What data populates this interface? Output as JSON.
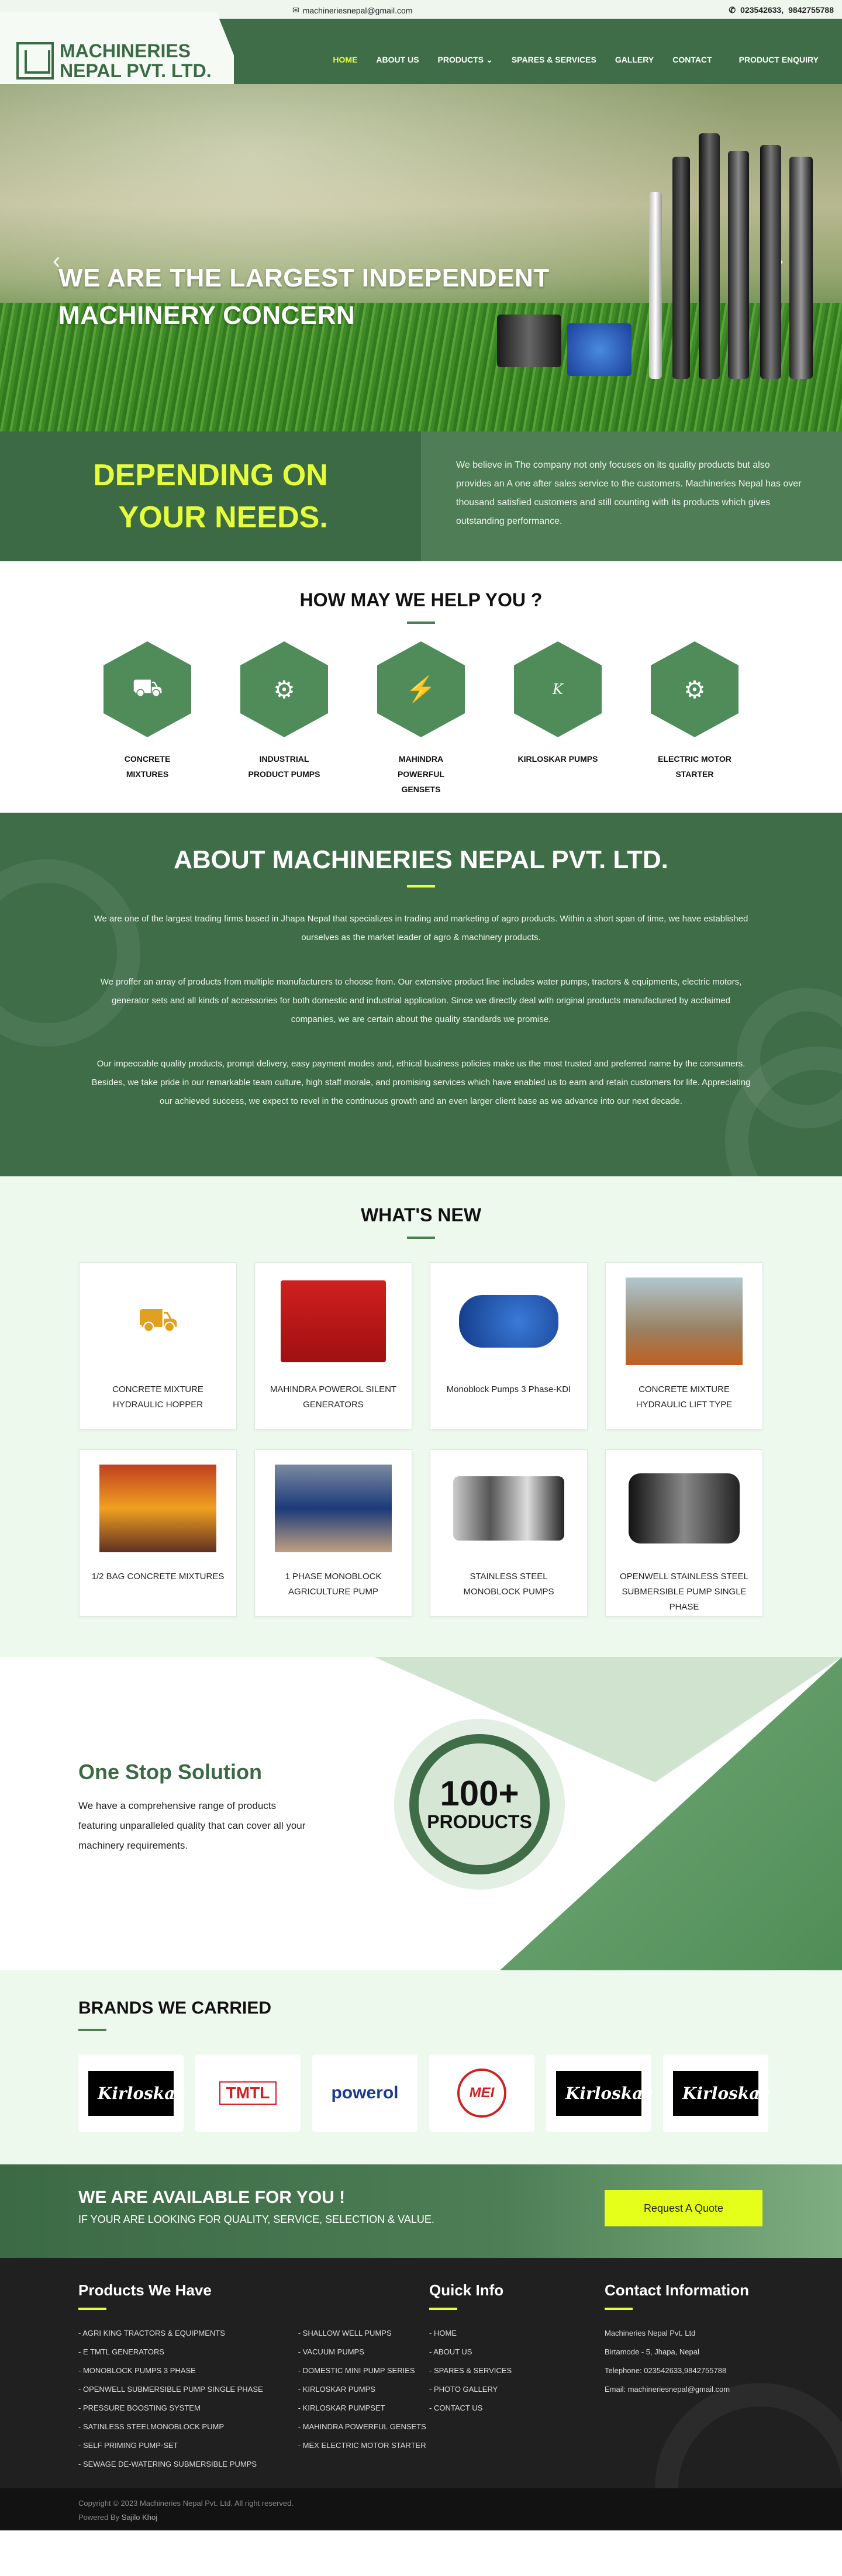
{
  "topbar": {
    "email": "machineriesnepal@gmail.com",
    "phone1": "023542633,",
    "phone2": "9842755788"
  },
  "brand": {
    "line1": "MACHINERIES",
    "line2": "NEPAL PVT. LTD."
  },
  "nav": {
    "home": "HOME",
    "about": "ABOUT US",
    "products": "PRODUCTS",
    "spares": "SPARES & SERVICES",
    "gallery": "GALLERY",
    "contact": "CONTACT",
    "enquiry": "PRODUCT ENQUIRY"
  },
  "hero": {
    "line1": "WE ARE THE LARGEST INDEPENDENT",
    "line2": "MACHINERY CONCERN"
  },
  "depend": {
    "line1": "DEPENDING ON",
    "line2": "YOUR NEEDS.",
    "text": "We believe in The company not only focuses on its quality products but also provides an A one after sales service to the customers. Machineries Nepal has over thousand satisfied customers and still counting with its products which gives outstanding performance."
  },
  "help": {
    "title": "HOW MAY WE HELP YOU ?",
    "items": [
      {
        "label": "CONCRETE MIXTURES",
        "icon": "mixer-truck-icon"
      },
      {
        "label": "INDUSTRIAL PRODUCT PUMPS",
        "icon": "pump-icon"
      },
      {
        "label": "MAHINDRA POWERFUL GENSETS",
        "icon": "generator-icon"
      },
      {
        "label": "KIRLOSKAR PUMPS",
        "icon": "kirloskar-icon"
      },
      {
        "label": "ELECTRIC MOTOR STARTER",
        "icon": "motor-icon"
      }
    ]
  },
  "about": {
    "title": "ABOUT MACHINERIES NEPAL PVT. LTD.",
    "p1": "We are one of the largest trading firms based in Jhapa Nepal that specializes in trading and marketing of agro products. Within a short span of time, we have established ourselves as the market leader of agro & machinery products.",
    "p2": "We proffer an array of products from multiple manufacturers to choose from. Our extensive product line includes water pumps, tractors & equipments, electric motors, generator sets and all kinds of accessories for both domestic and industrial application. Since we directly deal with original products manufactured by acclaimed companies, we are certain about the quality standards we promise.",
    "p3": "Our impeccable quality products, prompt delivery, easy payment modes and, ethical business policies make us the most trusted and preferred name by the consumers. Besides, we take pride in our remarkable team culture, high staff morale, and promising services which have enabled us to earn and retain customers for life. Appreciating our achieved success, we expect to revel in the continuous growth and an even larger client base as we advance into our next decade."
  },
  "new": {
    "title": "WHAT'S NEW",
    "items": [
      {
        "l1": "CONCRETE MIXTURE",
        "l2": "HYDRAULIC HOPPER"
      },
      {
        "l1": "MAHINDRA POWEROL SILENT",
        "l2": "GENERATORS"
      },
      {
        "l1": "Monoblock Pumps 3 Phase-KDI",
        "l2": ""
      },
      {
        "l1": "CONCRETE MIXTURE",
        "l2": "HYDRAULIC LIFT TYPE"
      },
      {
        "l1": "1/2 BAG CONCRETE MIXTURES",
        "l2": ""
      },
      {
        "l1": "1 PHASE MONOBLOCK",
        "l2": "AGRICULTURE PUMP"
      },
      {
        "l1": "STAINLESS STEEL",
        "l2": "MONOBLOCK PUMPS"
      },
      {
        "l1": "OPENWELL STAINLESS STEEL",
        "l2": "SUBMERSIBLE PUMP SINGLE",
        "l3": "PHASE"
      }
    ]
  },
  "onestop": {
    "title": "One Stop Solution",
    "text": "We have a comprehensive range of products featuring unparalleled quality that can cover all your machinery requirements.",
    "count": "100+",
    "word": "PRODUCTS"
  },
  "brands": {
    "title": "BRANDS WE CARRIED",
    "items": [
      "Kirloskar",
      "TMTL",
      "powerol",
      "MEI",
      "Kirloskar",
      "Kirloskar"
    ]
  },
  "cta": {
    "title": "WE ARE AVAILABLE FOR YOU !",
    "sub": "IF YOUR ARE LOOKING FOR QUALITY, SERVICE, SELECTION & VALUE.",
    "button": "Request A Quote"
  },
  "footer": {
    "products_title": "Products We Have",
    "col1": [
      "AGRI KING TRACTORS & EQUIPMENTS",
      "E TMTL GENERATORS",
      "MONOBLOCK PUMPS 3 PHASE",
      "OPENWELL SUBMERSIBLE PUMP SINGLE PHASE",
      "PRESSURE BOOSTING SYSTEM",
      "SATINLESS STEELMONOBLOCK PUMP",
      "SELF PRIMING PUMP-SET",
      "SEWAGE DE-WATERING SUBMERSIBLE PUMPS"
    ],
    "col2": [
      "SHALLOW WELL PUMPS",
      "VACUUM PUMPS",
      "DOMESTIC MINI PUMP SERIES",
      "KIRLOSKAR PUMPS",
      "KIRLOSKAR PUMPSET",
      "MAHINDRA POWERFUL GENSETS",
      "MEX ELECTRIC MOTOR STARTER"
    ],
    "quick_title": "Quick Info",
    "quick": [
      "HOME",
      "ABOUT US",
      "SPARES & SERVICES",
      "PHOTO GALLERY",
      "CONTACT US"
    ],
    "contact_title": "Contact Information",
    "contact": [
      "Machineries Nepal Pvt. Ltd",
      "Birtamode - 5, Jhapa, Nepal",
      "Telephone: 023542633,9842755788",
      "Email: machineriesnepal@gmail.com"
    ]
  },
  "copy": {
    "line1": "Copyright © 2023 Machineries Nepal Pvt. Ltd. All right reserved.",
    "powered": "Powered By",
    "by": "Sajilo Khoj"
  },
  "colors": {
    "primary": "#3f6d48",
    "accent": "#e6ff3a",
    "dark": "#202020"
  }
}
